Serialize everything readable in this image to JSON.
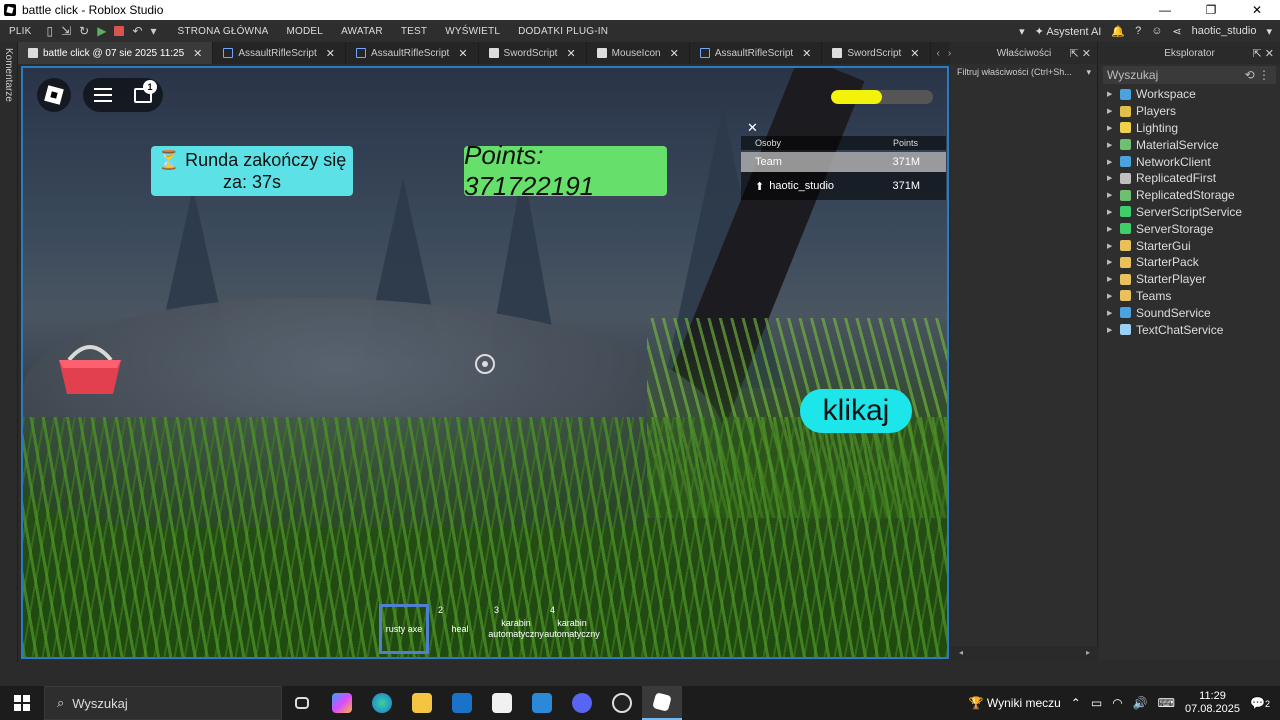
{
  "window": {
    "title": "battle click - Roblox Studio",
    "controls": [
      "—",
      "❐",
      "✕"
    ]
  },
  "menu": {
    "items": [
      "PLIK",
      "STRONA GŁÓWNA",
      "MODEL",
      "AWATAR",
      "TEST",
      "WYŚWIETL",
      "DODATKI PLUG-IN"
    ],
    "assistant_label": "Asystent AI",
    "user": "haotic_studio"
  },
  "side_strip_label": "Komentarze",
  "tabs": [
    {
      "label": "battle click @ 07 sie 2025 11:25",
      "icon": "roblox-icon",
      "active": true
    },
    {
      "label": "AssaultRifleScript",
      "icon": "script-icon"
    },
    {
      "label": "AssaultRifleScript",
      "icon": "script-icon"
    },
    {
      "label": "SwordScript",
      "icon": "doc-icon"
    },
    {
      "label": "MouseIcon",
      "icon": "doc-icon"
    },
    {
      "label": "AssaultRifleScript",
      "icon": "script-icon"
    },
    {
      "label": "SwordScript",
      "icon": "doc-icon"
    }
  ],
  "game": {
    "chat_badge": "1",
    "round_text": "⏳ Runda zakończy się za: 37s",
    "points_text": "Points: 371722191",
    "progress": 0.5,
    "leaderboard": {
      "col_people": "Osoby",
      "col_points": "Points",
      "team_name": "Team",
      "team_points": "371M",
      "player_name": "haotic_studio",
      "player_points": "371M"
    },
    "click_button": "klikaj",
    "hotbar": [
      {
        "num": "",
        "label": "rusty axe",
        "selected": true
      },
      {
        "num": "2",
        "label": "heal"
      },
      {
        "num": "3",
        "label": "karabin automatyczny"
      },
      {
        "num": "4",
        "label": "karabin automatyczny"
      }
    ]
  },
  "properties": {
    "title": "Właściwości",
    "filter_placeholder": "Filtruj właściwości (Ctrl+Sh..."
  },
  "explorer": {
    "title": "Eksplorator",
    "search_placeholder": "Wyszukaj",
    "items": [
      {
        "label": "Workspace",
        "color": "#4aa3df"
      },
      {
        "label": "Players",
        "color": "#e0c04a"
      },
      {
        "label": "Lighting",
        "color": "#f2d14a"
      },
      {
        "label": "MaterialService",
        "color": "#6fbf73"
      },
      {
        "label": "NetworkClient",
        "color": "#4aa3df"
      },
      {
        "label": "ReplicatedFirst",
        "color": "#c0c0c0"
      },
      {
        "label": "ReplicatedStorage",
        "color": "#6fbf73"
      },
      {
        "label": "ServerScriptService",
        "color": "#3ecf6a"
      },
      {
        "label": "ServerStorage",
        "color": "#3ecf6a"
      },
      {
        "label": "StarterGui",
        "color": "#e8c15a"
      },
      {
        "label": "StarterPack",
        "color": "#e8c15a"
      },
      {
        "label": "StarterPlayer",
        "color": "#e8c15a"
      },
      {
        "label": "Teams",
        "color": "#e8c15a"
      },
      {
        "label": "SoundService",
        "color": "#4aa3df"
      },
      {
        "label": "TextChatService",
        "color": "#9ad0f5"
      }
    ]
  },
  "taskbar": {
    "search_placeholder": "Wyszukaj",
    "widget": "Wyniki meczu",
    "time": "11:29",
    "date": "07.08.2025",
    "notifications": "2"
  }
}
